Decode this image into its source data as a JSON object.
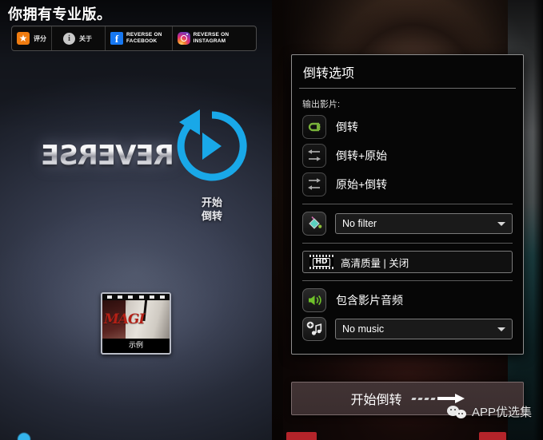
{
  "left": {
    "pro_title": "你拥有专业版。",
    "toolbar": [
      {
        "icon": "star-icon",
        "label": "评分"
      },
      {
        "icon": "info-icon",
        "label": "关于"
      },
      {
        "icon": "facebook-icon",
        "line1": "REVERSE ON",
        "line2": "FACEBOOK"
      },
      {
        "icon": "instagram-icon",
        "line1": "REVERSE ON",
        "line2": "INSTAGRAM"
      }
    ],
    "wordmark": "REVERSE",
    "start_button_label_line1": "开始",
    "start_button_label_line2": "倒转",
    "sample": {
      "overlay_text": "MAGI",
      "caption": "示例"
    }
  },
  "dialog": {
    "title": "倒转选项",
    "section_label": "输出影片:",
    "options": [
      {
        "label": "倒转",
        "icon": "reverse-arrow-icon",
        "selected": true
      },
      {
        "label": "倒转+原始",
        "icon": "reverse-then-original-icon",
        "selected": false
      },
      {
        "label": "原始+倒转",
        "icon": "original-then-reverse-icon",
        "selected": false
      }
    ],
    "filter": {
      "icon": "paint-bucket-icon",
      "value": "No filter"
    },
    "quality": {
      "icon": "hd-filmstrip-icon",
      "badge": "HD",
      "label": "高清质量 | 关闭"
    },
    "audio": {
      "icon": "speaker-icon",
      "label": "包含影片音频"
    },
    "music": {
      "icon": "add-music-icon",
      "value": "No music"
    },
    "start_label": "开始倒转"
  },
  "watermark": {
    "text": "APP优选集",
    "icon": "wechat-icon"
  },
  "colors": {
    "accent_cyan": "#19a8e8",
    "accent_green": "#7cb342",
    "accent_orange": "#f07c10",
    "facebook_blue": "#1778f2",
    "red_bar": "#b4242a"
  }
}
